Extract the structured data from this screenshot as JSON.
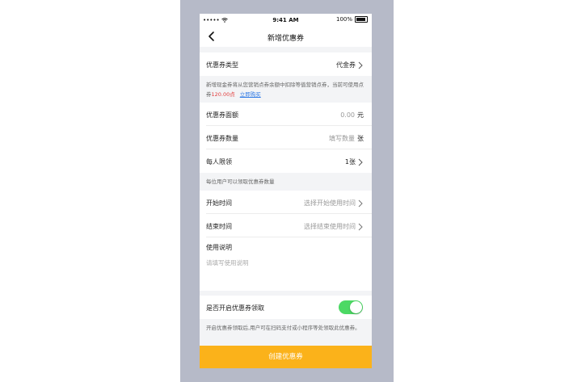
{
  "status_bar": {
    "signal": "•••••",
    "time": "9:41 AM",
    "battery": "100%"
  },
  "nav": {
    "title": "新增优惠券"
  },
  "coupon_type": {
    "label": "优惠券类型",
    "value": "代金券"
  },
  "coupon_note": {
    "prefix": "新增现金券将从您营销点券余额中扣除等值营销点券，当前可使用点券",
    "points": "120.00点",
    "buy_link": "立即购买"
  },
  "face_value": {
    "label": "优惠券面额",
    "value": "0.00",
    "unit": "元"
  },
  "quantity": {
    "label": "优惠券数量",
    "placeholder": "填写数量",
    "unit": "张"
  },
  "limit": {
    "label": "每人限领",
    "value": "1张"
  },
  "limit_note": "每位用户可以领取优惠券数量",
  "start_time": {
    "label": "开始时间",
    "placeholder": "选择开始使用时间"
  },
  "end_time": {
    "label": "结束时间",
    "placeholder": "选择结束使用时间"
  },
  "description": {
    "label": "使用说明",
    "placeholder": "请填写使用说明"
  },
  "enable": {
    "label": "是否开启优惠券领取",
    "on": true
  },
  "enable_note": "开启优惠券领取后,用户可在扫码支付或小程序等处领取此优惠券。",
  "cta": {
    "label": "创建优惠券"
  },
  "colors": {
    "accent": "#fbb21a",
    "toggle_on": "#4cd964",
    "link": "#2f7ae5",
    "highlight": "#e23b3b"
  }
}
